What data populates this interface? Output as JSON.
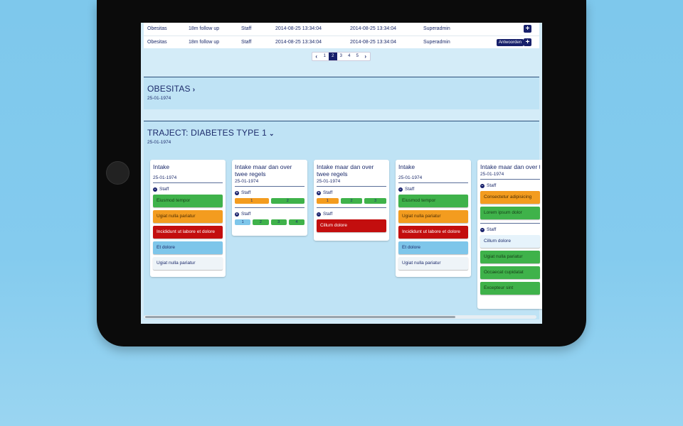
{
  "table": {
    "rows": [
      {
        "name": "Obesitas",
        "type": "18m follow up",
        "role": "Staff",
        "created": "2014-08-25 13:34:04",
        "updated": "2014-08-25 13:34:04",
        "user": "Superadmin",
        "action": ""
      },
      {
        "name": "Obesitas",
        "type": "18m follow up",
        "role": "Staff",
        "created": "2014-08-25 13:34:04",
        "updated": "2014-08-25 13:34:04",
        "user": "Superadmin",
        "action": "Antwoorden"
      }
    ]
  },
  "pagination": {
    "pages": [
      "1",
      "2",
      "3",
      "4",
      "5"
    ],
    "active": "2",
    "prev": "‹",
    "next": "›"
  },
  "panels": {
    "obesitas": {
      "title": "OBESITAS",
      "chevron": "›",
      "date": "25-01-1974"
    },
    "traject": {
      "title": "TRAJECT: DIABETES TYPE 1",
      "chevron": "⌄",
      "date": "25-01-1974"
    }
  },
  "cards": [
    {
      "title": "Intake",
      "date": "25-01-1974",
      "staff": "Staff",
      "tasks": [
        {
          "label": "Eiusmod tempor",
          "color": "green"
        },
        {
          "label": "Ugiat nulla pariatur",
          "color": "orange"
        },
        {
          "label": "Incididunt ut labore et dolore",
          "color": "red"
        },
        {
          "label": "Et dolore",
          "color": "blue"
        },
        {
          "label": "Ugiat nulla pariatur",
          "color": "white"
        }
      ]
    },
    {
      "title": "Intake maar dan over twee regels",
      "date": "25-01-1974",
      "groups": [
        {
          "staff": "Staff",
          "steps": [
            {
              "label": "1",
              "color": "orange"
            },
            {
              "label": "2",
              "color": "green"
            }
          ]
        },
        {
          "staff": "Staff",
          "steps": [
            {
              "label": "1",
              "color": "blue"
            },
            {
              "label": "2",
              "color": "green"
            },
            {
              "label": "3",
              "color": "green"
            },
            {
              "label": "4",
              "color": "green"
            }
          ]
        }
      ]
    },
    {
      "title": "Intake maar dan over twee regels",
      "date": "25-01-1974",
      "groups": [
        {
          "staff": "Staff",
          "steps": [
            {
              "label": "1",
              "color": "orange"
            },
            {
              "label": "2",
              "color": "green"
            },
            {
              "label": "3",
              "color": "green"
            }
          ]
        },
        {
          "staff": "Staff",
          "task": {
            "label": "Cillum dolore",
            "color": "red"
          }
        }
      ]
    },
    {
      "title": "Intake",
      "date": "25-01-1974",
      "staff": "Staff",
      "tasks": [
        {
          "label": "Eiusmod tempor",
          "color": "green"
        },
        {
          "label": "Ugiat nulla pariatur",
          "color": "orange"
        },
        {
          "label": "Incididunt ut labore et dolore",
          "color": "red"
        },
        {
          "label": "Et dolore",
          "color": "blue"
        },
        {
          "label": "Ugiat nulla pariatur",
          "color": "white"
        }
      ]
    },
    {
      "title": "Intake maar dan over twee regels",
      "date": "25-01-1974",
      "staff1": "Staff",
      "tasks1": [
        {
          "label": "Consectetur adipisicing",
          "color": "orange"
        },
        {
          "label": "Lorem ipsum dolor",
          "color": "green"
        }
      ],
      "staff2": "Staff",
      "tasks2": [
        {
          "label": "Cillum dolore",
          "color": "lightblue"
        },
        {
          "label": "Ugiat nulla pariatur",
          "color": "green"
        },
        {
          "label": "Occaecat cupidatat",
          "color": "green"
        },
        {
          "label": "Excepteur sint",
          "color": "green"
        }
      ]
    }
  ]
}
